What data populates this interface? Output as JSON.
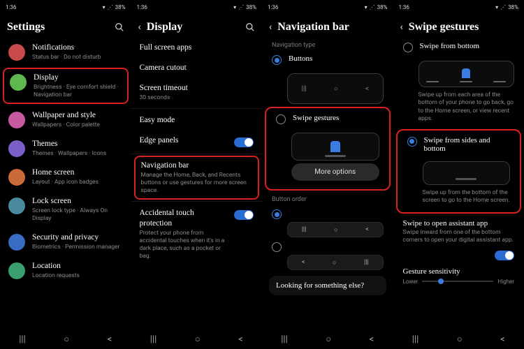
{
  "status": {
    "time": "1:36",
    "battery": "38%"
  },
  "screen1": {
    "title": "Settings",
    "items": [
      {
        "icon": "bell-icon",
        "color": "#c94a4a",
        "label": "Notifications",
        "sub": "Status bar  ·  Do not disturb"
      },
      {
        "icon": "display-icon",
        "color": "#5fb84f",
        "label": "Display",
        "sub": "Brightness  ·  Eye comfort shield  ·  Navigation bar",
        "highlight": true
      },
      {
        "icon": "palette-icon",
        "color": "#c75aa0",
        "label": "Wallpaper and style",
        "sub": "Wallpapers  ·  Color palette"
      },
      {
        "icon": "themes-icon",
        "color": "#7a5fc9",
        "label": "Themes",
        "sub": "Themes  ·  Wallpapers  ·  Icons"
      },
      {
        "icon": "home-icon",
        "color": "#c96a3a",
        "label": "Home screen",
        "sub": "Layout  ·  App icon badges"
      },
      {
        "icon": "lock-icon",
        "color": "#4a8a9f",
        "label": "Lock screen",
        "sub": "Screen lock type  ·  Always On Display"
      },
      {
        "icon": "shield-icon",
        "color": "#3a6cc4",
        "label": "Security and privacy",
        "sub": "Biometrics  ·  Permission manager"
      },
      {
        "icon": "location-icon",
        "color": "#3a9f6f",
        "label": "Location",
        "sub": "Location requests"
      }
    ]
  },
  "screen2": {
    "title": "Display",
    "items": [
      {
        "label": "Full screen apps"
      },
      {
        "label": "Camera cutout"
      },
      {
        "label": "Screen timeout",
        "sub": "30 seconds",
        "sublink": true
      },
      {
        "label": "Easy mode"
      },
      {
        "label": "Edge panels",
        "toggle": true
      },
      {
        "label": "Navigation bar",
        "sub": "Manage the Home, Back, and Recents buttons or use gestures for more screen space.",
        "highlight": true
      },
      {
        "label": "Accidental touch protection",
        "sub": "Protect your phone from accidental touches when it's in a dark place, such as a pocket or bag.",
        "toggle": true
      }
    ]
  },
  "screen3": {
    "title": "Navigation bar",
    "nav_type_label": "Navigation type",
    "buttons_label": "Buttons",
    "swipe_label": "Swipe gestures",
    "more_options": "More options",
    "button_order_label": "Button order",
    "looking_label": "Looking for something else?"
  },
  "screen4": {
    "title": "Swipe gestures",
    "from_bottom_label": "Swipe from bottom",
    "from_bottom_desc": "Swipe up from each area of the bottom of your phone to go back, go to the Home screen, or view recent apps.",
    "from_sides_label": "Swipe from sides and bottom",
    "from_sides_desc": "Swipe up from the bottom of the screen to go to the Home screen.",
    "assist_label": "Swipe to open assistant app",
    "assist_desc": "Swipe inward from one of the bottom corners to open your digital assistant app.",
    "sens_label": "Gesture sensitivity",
    "sens_lower": "Lower",
    "sens_higher": "Higher"
  },
  "nav": {
    "recents": "|||",
    "home": "○",
    "back": "<"
  }
}
